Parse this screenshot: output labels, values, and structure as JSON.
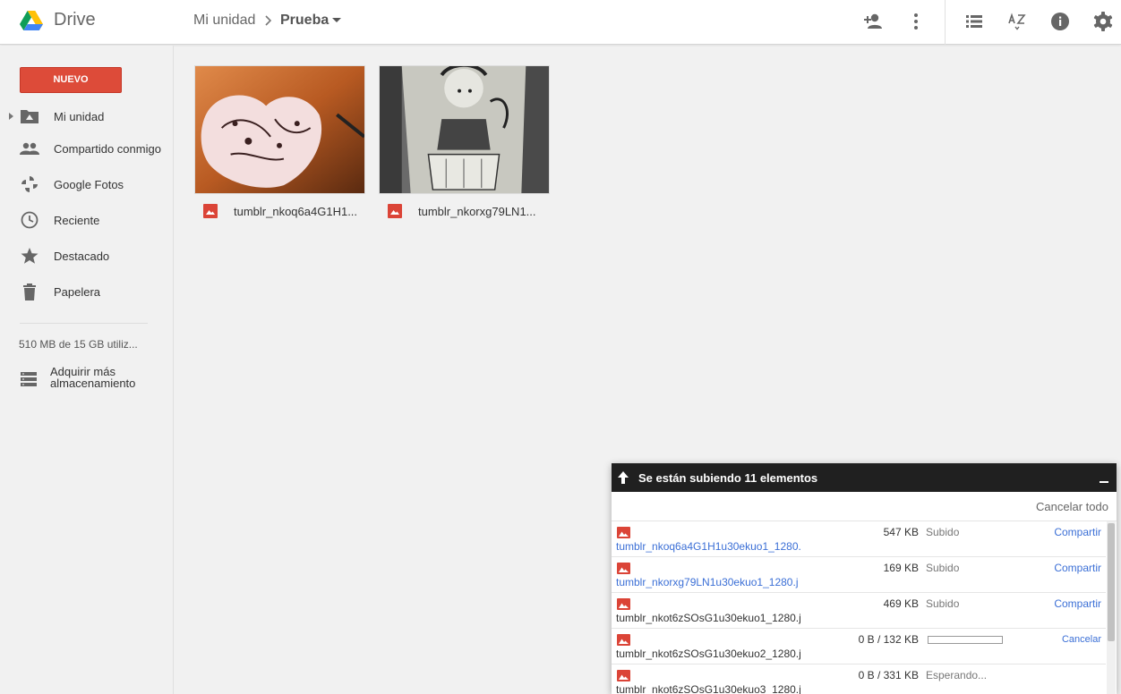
{
  "header": {
    "app_title": "Drive",
    "breadcrumb": {
      "root": "Mi unidad",
      "current": "Prueba"
    },
    "icons": [
      "share-person-add-icon",
      "more-vert-icon",
      "list-view-icon",
      "sort-az-icon",
      "info-icon",
      "settings-icon"
    ]
  },
  "sidebar": {
    "new_button": "NUEVO",
    "items": [
      {
        "label": "Mi unidad",
        "icon": "drive-folder-icon"
      },
      {
        "label": "Compartido conmigo",
        "icon": "people-icon"
      },
      {
        "label": "Google Fotos",
        "icon": "pinwheel-icon"
      },
      {
        "label": "Reciente",
        "icon": "clock-icon"
      },
      {
        "label": "Destacado",
        "icon": "star-icon"
      },
      {
        "label": "Papelera",
        "icon": "trash-icon"
      }
    ],
    "storage": "510 MB de 15 GB utiliz...",
    "buy_storage": "Adquirir más almacenamiento"
  },
  "files": [
    {
      "name": "tumblr_nkoq6a4G1H1...",
      "icon": "image-file-icon"
    },
    {
      "name": "tumblr_nkorxg79LN1...",
      "icon": "image-file-icon"
    }
  ],
  "upload_panel": {
    "title": "Se están subiendo 11 elementos",
    "cancel_all": "Cancelar todo",
    "rows": [
      {
        "size": "547 KB",
        "status": "Subido",
        "action": "Compartir",
        "name": "tumblr_nkoq6a4G1H1u30ekuo1_1280."
      },
      {
        "size": "169 KB",
        "status": "Subido",
        "action": "Compartir",
        "name": "tumblr_nkorxg79LN1u30ekuo1_1280.j"
      },
      {
        "size": "469 KB",
        "status": "Subido",
        "action": "Compartir",
        "name": "tumblr_nkot6zSOsG1u30ekuo1_1280.j"
      },
      {
        "size": "0 B / 132 KB",
        "status": "",
        "action": "Cancelar",
        "name": "tumblr_nkot6zSOsG1u30ekuo2_1280.j",
        "progress": 0
      },
      {
        "size": "0 B / 331 KB",
        "status": "Esperando...",
        "action": "",
        "name": "tumblr_nkot6zSOsG1u30ekuo3_1280.j"
      }
    ]
  },
  "colors": {
    "new_button": "#dd4b39",
    "link": "#3b6fd6",
    "panel_header": "#202020"
  }
}
